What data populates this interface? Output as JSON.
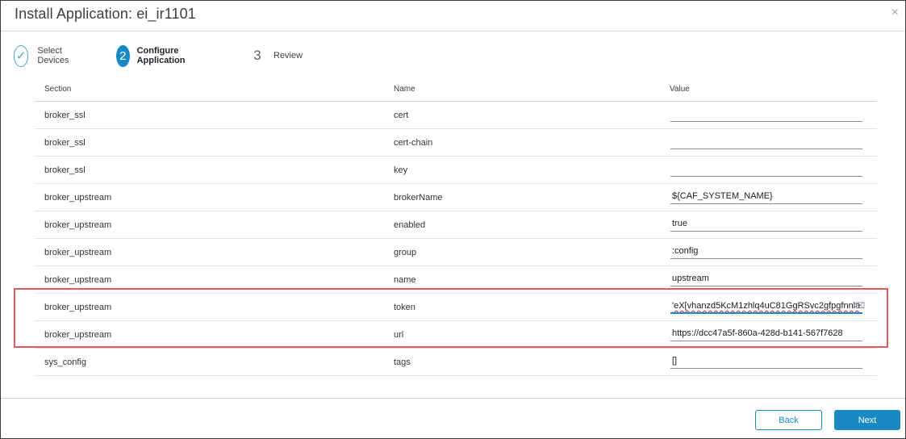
{
  "dialog": {
    "title": "Install Application: ei_ir1101",
    "close_glyph": "×"
  },
  "steps": [
    {
      "label": "Select Devices",
      "state": "done",
      "glyph": "✓"
    },
    {
      "label": "Configure Application",
      "state": "active",
      "number": "2"
    },
    {
      "label": "Review",
      "state": "pending",
      "number": "3"
    }
  ],
  "table": {
    "headers": {
      "section": "Section",
      "name": "Name",
      "value": "Value"
    },
    "rows": [
      {
        "section": "broker_ssl",
        "name": "cert",
        "value": ""
      },
      {
        "section": "broker_ssl",
        "name": "cert-chain",
        "value": ""
      },
      {
        "section": "broker_ssl",
        "name": "key",
        "value": ""
      },
      {
        "section": "broker_upstream",
        "name": "brokerName",
        "value": "${CAF_SYSTEM_NAME}"
      },
      {
        "section": "broker_upstream",
        "name": "enabled",
        "value": "true"
      },
      {
        "section": "broker_upstream",
        "name": "group",
        "value": ":config"
      },
      {
        "section": "broker_upstream",
        "name": "name",
        "value": "upstream"
      },
      {
        "section": "broker_upstream",
        "name": "token",
        "value": "'eX[vhanzd5KcM1zhlq4uC81GgRSvc2gfpgfnnla"
      },
      {
        "section": "broker_upstream",
        "name": "url",
        "value": "https://dcc47a5f-860a-428d-b141-567f7628"
      },
      {
        "section": "sys_config",
        "name": "tags",
        "value": "[]"
      }
    ]
  },
  "buttons": {
    "back": "Back",
    "next": "Next"
  },
  "colors": {
    "accent": "#1989c4",
    "highlight": "#e05a5a"
  }
}
